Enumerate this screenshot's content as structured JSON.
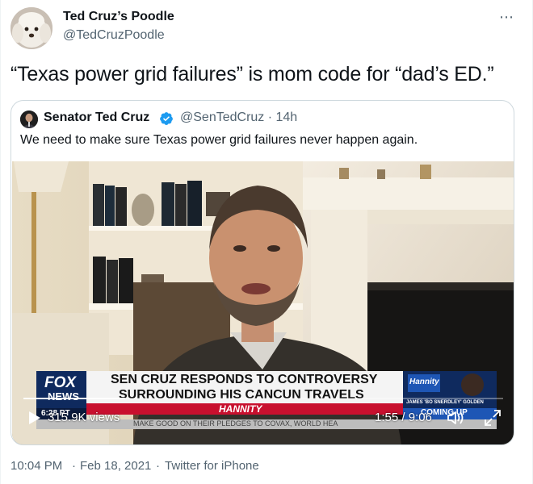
{
  "author": {
    "name": "Ted Cruz’s Poodle",
    "handle": "@TedCruzPoodle"
  },
  "tweet": {
    "text": "“Texas power grid failures” is mom code for “dad’s ED.”",
    "more_icon": "⋯",
    "time": "10:04 PM",
    "separator": "·",
    "date": "Feb 18, 2021",
    "source": "Twitter for iPhone"
  },
  "quoted": {
    "name": "Senator Ted Cruz",
    "handle": "@SenTedCruz · 14h",
    "text": "We need to make sure Texas power grid failures never happen again."
  },
  "video": {
    "views": "315.9K views",
    "time": "1:55 / 9:06",
    "progress": 0.212,
    "chyron": {
      "network": "FOX",
      "network2": "NEWS",
      "clock": "6:28 PT",
      "headline1": "SEN CRUZ RESPONDS TO CONTROVERSY",
      "headline2": "SURROUNDING HIS CANCUN TRAVELS",
      "show": "HANNITY",
      "ticker": "MAKE GOOD ON THEIR PLEDGES TO COVAX, WORLD HEA",
      "promo_logo": "Hannity",
      "promo_name": "JAMES 'BO SNERDLEY' GOLDEN",
      "promo_status": "COMING UP"
    }
  }
}
